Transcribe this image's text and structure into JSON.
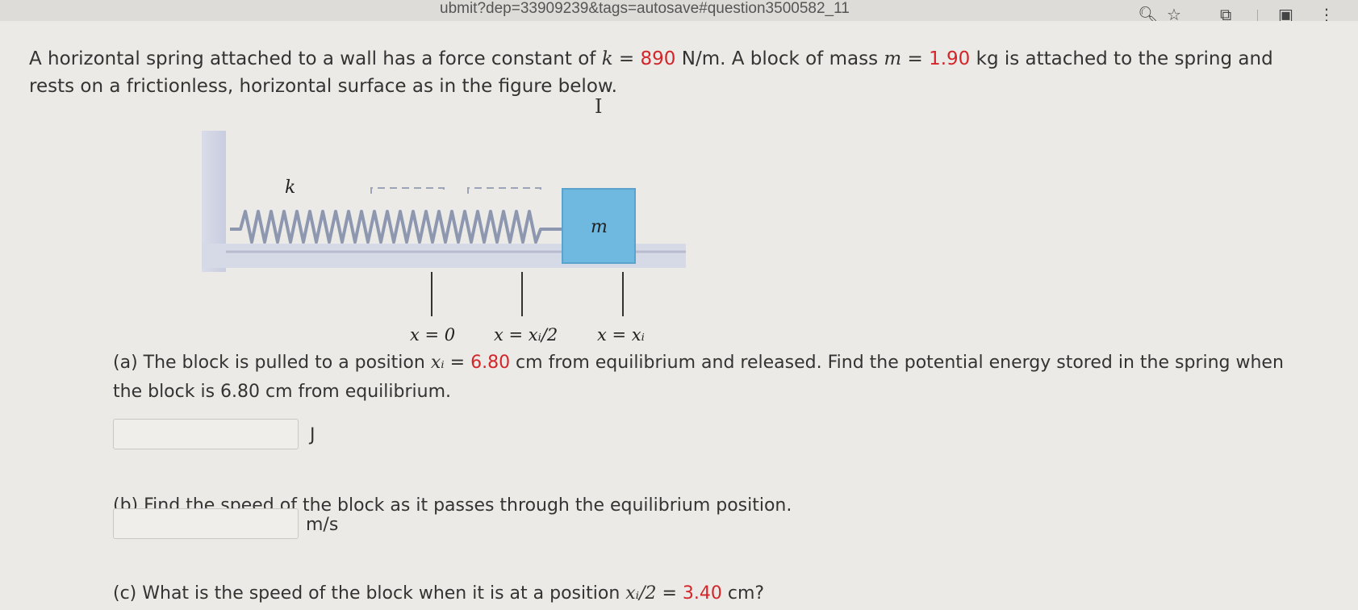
{
  "browser": {
    "url_fragment": "ubmit?dep=33909239&tags=autosave#question3500582_11",
    "icons": [
      "zoom-icon",
      "bookmark-star-icon",
      "extensions-icon",
      "sidebar-icon",
      "menu-icon"
    ]
  },
  "problem": {
    "intro_before_k": "A horizontal spring attached to a wall has a force constant of ",
    "k_var": "k",
    "k_eq": " = ",
    "k_value": "890",
    "k_unit": " N/m. A block of mass ",
    "m_var": "m",
    "m_eq": " = ",
    "m_value": "1.90",
    "m_unit": " kg is attached to the spring and rests on a frictionless, horizontal surface as in the figure below."
  },
  "figure": {
    "spring_label": "k",
    "block_label": "m",
    "pos_labels": [
      "x = 0",
      "x = xᵢ/2",
      "x = xᵢ"
    ]
  },
  "part_a": {
    "prefix": "(a) The block is pulled to a position ",
    "var": "xᵢ",
    "eq": " = ",
    "value": "6.80",
    "rest": " cm from equilibrium and released. Find the potential energy stored in the spring when the block is 6.80 cm from equilibrium.",
    "unit": "J"
  },
  "part_b": {
    "text": "(b) Find the speed of the block as it passes through the equilibrium position.",
    "unit": "m/s"
  },
  "part_c": {
    "prefix": "(c) What is the speed of the block when it is at a position ",
    "var": "xᵢ/2",
    "eq": " = ",
    "value": "3.40",
    "rest": " cm?"
  },
  "colors": {
    "accent_red": "#d2262b",
    "block_fill": "#6fb8e0",
    "spring": "#8e97b0"
  }
}
